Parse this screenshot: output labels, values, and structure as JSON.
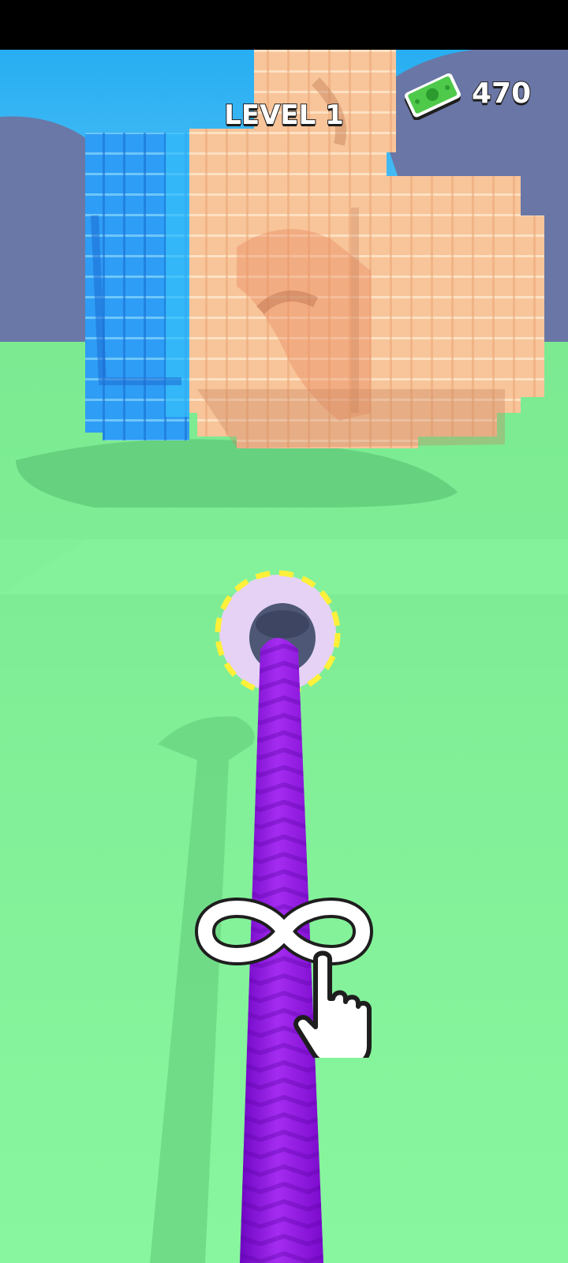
{
  "hud": {
    "level_label": "LEVEL 1",
    "currency_icon": "cash-icon",
    "currency_value": "470"
  },
  "tutorial": {
    "gesture_icon": "infinity-icon",
    "pointer_icon": "hand-pointer-icon"
  },
  "colors": {
    "ground": "#86F39C",
    "sky": "#2FB4F0",
    "rope": "#9B16E8",
    "hole_ring": "#E7D3F2",
    "hole_dash": "#FFF22E",
    "cube_peach": "#F9C69C",
    "cube_blue": "#2AA7F5"
  }
}
